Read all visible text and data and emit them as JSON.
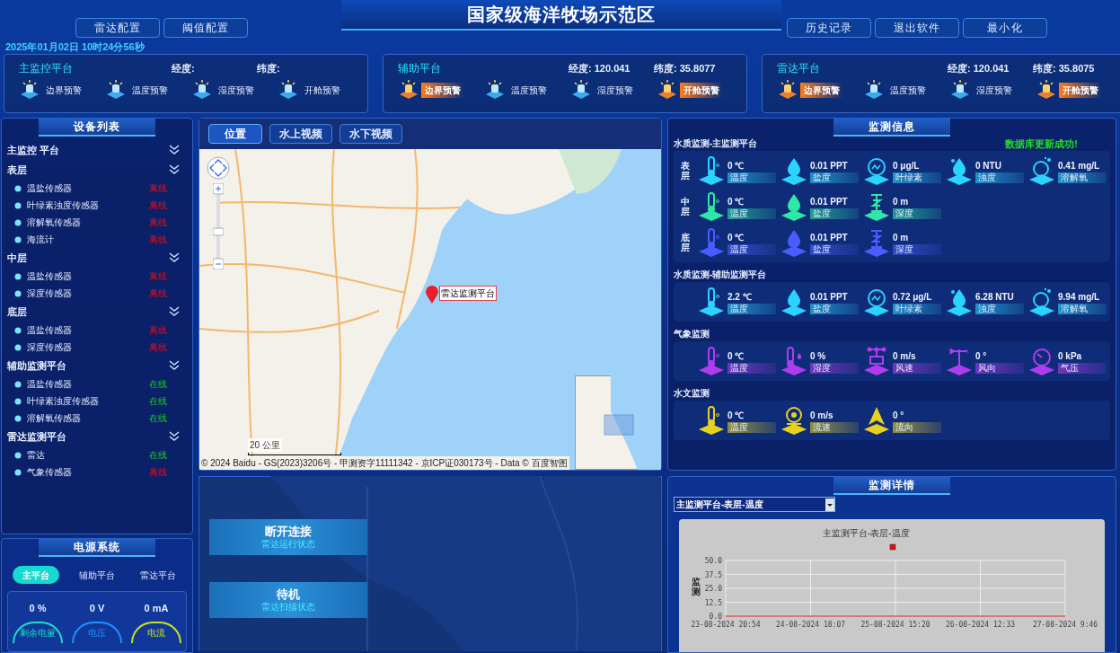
{
  "header": {
    "title": "国家级海洋牧场示范区",
    "left_buttons": [
      "雷达配置",
      "阈值配置"
    ],
    "right_buttons": [
      "历史记录",
      "退出软件",
      "最小化"
    ],
    "datetime": "2025年01月02日 10时24分56秒"
  },
  "platforms": [
    {
      "name": "主监控平台",
      "lon_label": "经度:",
      "lat_label": "纬度:",
      "alarms": [
        {
          "label": "边界预警",
          "active": false
        },
        {
          "label": "温度预警",
          "active": false
        },
        {
          "label": "湿度预警",
          "active": false
        },
        {
          "label": "开舱预警",
          "active": false
        }
      ]
    },
    {
      "name": "辅助平台",
      "lon_label": "经度:",
      "lon": "120.041",
      "lat_label": "纬度:",
      "lat": "35.8077",
      "alarms": [
        {
          "label": "边界预警",
          "active": true
        },
        {
          "label": "温度预警",
          "active": false
        },
        {
          "label": "湿度预警",
          "active": false
        },
        {
          "label": "开舱预警",
          "active": true
        }
      ]
    },
    {
      "name": "雷达平台",
      "lon_label": "经度:",
      "lon": "120.041",
      "lat_label": "纬度:",
      "lat": "35.8075",
      "alarms": [
        {
          "label": "边界预警",
          "active": true
        },
        {
          "label": "温度预警",
          "active": false
        },
        {
          "label": "湿度预警",
          "active": false
        },
        {
          "label": "开舱预警",
          "active": true
        }
      ]
    }
  ],
  "device_list": {
    "title": "设备列表",
    "groups": [
      {
        "label": "主监控 平台",
        "expanded": true,
        "children": [
          {
            "label": "表层",
            "expanded": true,
            "children": [
              {
                "label": "温盐传感器",
                "status": "离线",
                "online": false
              },
              {
                "label": "叶绿素浊度传感器",
                "status": "离线",
                "online": false
              },
              {
                "label": "溶解氧传感器",
                "status": "离线",
                "online": false
              },
              {
                "label": "海流计",
                "status": "离线",
                "online": false
              }
            ]
          },
          {
            "label": "中层",
            "expanded": true,
            "children": [
              {
                "label": "温盐传感器",
                "status": "离线",
                "online": false
              },
              {
                "label": "深度传感器",
                "status": "离线",
                "online": false
              }
            ]
          },
          {
            "label": "底层",
            "expanded": true,
            "children": [
              {
                "label": "温盐传感器",
                "status": "离线",
                "online": false
              },
              {
                "label": "深度传感器",
                "status": "离线",
                "online": false
              }
            ]
          }
        ]
      },
      {
        "label": "辅助监测平台",
        "expanded": true,
        "children": [
          {
            "label": "温盐传感器",
            "status": "在线",
            "online": true
          },
          {
            "label": "叶绿素浊度传感器",
            "status": "在线",
            "online": true
          },
          {
            "label": "溶解氧传感器",
            "status": "在线",
            "online": true
          }
        ]
      },
      {
        "label": "雷达监测平台",
        "expanded": true,
        "children": [
          {
            "label": "雷达",
            "status": "在线",
            "online": true
          },
          {
            "label": "气象传感器",
            "status": "离线",
            "online": false
          }
        ]
      }
    ]
  },
  "power": {
    "title": "电源系统",
    "tabs": [
      {
        "label": "主平台",
        "selected": true
      },
      {
        "label": "辅助平台",
        "selected": false
      },
      {
        "label": "雷达平台",
        "selected": false
      }
    ],
    "readings": [
      {
        "value": "0 %",
        "label": "剩余电量",
        "color": "#19e0c0"
      },
      {
        "value": "0 V",
        "label": "电压",
        "color": "#1e90ff"
      },
      {
        "value": "0 mA",
        "label": "电流",
        "color": "#c8e01e"
      }
    ]
  },
  "map_panel": {
    "tabs": [
      {
        "label": "位置",
        "selected": true
      },
      {
        "label": "水上视频",
        "selected": false
      },
      {
        "label": "水下视频",
        "selected": false
      }
    ],
    "marker_label": "雷达监测平台",
    "scale": "20 公里",
    "copyright": "© 2024 Baidu - GS(2023)3206号 - 甲测资字11111342 - 京ICP证030173号 - Data © 百度智图"
  },
  "radar_panel": {
    "buttons": [
      {
        "label": "断开连接",
        "sub": "雷达运行状态"
      },
      {
        "label": "待机",
        "sub": "雷达扫描状态"
      }
    ]
  },
  "monitor": {
    "title": "监测信息",
    "status": "数据库更新成功!",
    "sections": [
      {
        "title": "水质监测-主监测平台",
        "rows": [
          {
            "layer": "表层",
            "color": "#2ad4ff",
            "items": [
              {
                "kind": "temperature",
                "value": "0 ℃",
                "label": "温度"
              },
              {
                "kind": "salinity",
                "value": "0.01 PPT",
                "label": "盐度"
              },
              {
                "kind": "chlorophyll",
                "value": "0 μg/L",
                "label": "叶绿素"
              },
              {
                "kind": "turbidity",
                "value": "0 NTU",
                "label": "浊度"
              },
              {
                "kind": "oxygen",
                "value": "0.41 mg/L",
                "label": "溶解氧"
              }
            ]
          },
          {
            "layer": "中层",
            "color": "#2ee8a8",
            "items": [
              {
                "kind": "temperature",
                "value": "0 ℃",
                "label": "温度"
              },
              {
                "kind": "salinity",
                "value": "0.01 PPT",
                "label": "盐度"
              },
              {
                "kind": "depth",
                "value": "0 m",
                "label": "深度"
              }
            ]
          },
          {
            "layer": "底层",
            "color": "#4a5cff",
            "items": [
              {
                "kind": "temperature",
                "value": "0 ℃",
                "label": "温度"
              },
              {
                "kind": "salinity",
                "value": "0.01 PPT",
                "label": "盐度"
              },
              {
                "kind": "depth",
                "value": "0 m",
                "label": "深度"
              }
            ]
          }
        ]
      },
      {
        "title": "水质监测-辅助监测平台",
        "rows": [
          {
            "color": "#2ad4ff",
            "items": [
              {
                "kind": "temperature",
                "value": "2.2 ℃",
                "label": "温度"
              },
              {
                "kind": "salinity",
                "value": "0.01 PPT",
                "label": "盐度"
              },
              {
                "kind": "chlorophyll",
                "value": "0.72 μg/L",
                "label": "叶绿素"
              },
              {
                "kind": "turbidity",
                "value": "6.28 NTU",
                "label": "浊度"
              },
              {
                "kind": "oxygen",
                "value": "9.94 mg/L",
                "label": "溶解氧"
              }
            ]
          }
        ]
      },
      {
        "title": "气象监测",
        "rows": [
          {
            "color": "#b03cf0",
            "items": [
              {
                "kind": "temperature",
                "value": "0 ℃",
                "label": "温度"
              },
              {
                "kind": "humidity",
                "value": "0 %",
                "label": "湿度"
              },
              {
                "kind": "wind_speed",
                "value": "0 m/s",
                "label": "风速"
              },
              {
                "kind": "wind_direction",
                "value": "0 °",
                "label": "风向"
              },
              {
                "kind": "pressure",
                "value": "0 kPa",
                "label": "气压"
              }
            ]
          }
        ]
      },
      {
        "title": "水文监测",
        "rows": [
          {
            "color": "#e8d020",
            "items": [
              {
                "kind": "temperature",
                "value": "0 ℃",
                "label": "温度"
              },
              {
                "kind": "flow_speed",
                "value": "0 m/s",
                "label": "流速"
              },
              {
                "kind": "flow_direction",
                "value": "0 °",
                "label": "流向"
              }
            ]
          }
        ]
      }
    ]
  },
  "detail": {
    "title": "监测详情",
    "selector": "主监测平台-表层-温度",
    "chart_data": {
      "type": "line",
      "title": "主监测平台-表层-温度",
      "ylabel": "监测",
      "x": [
        "23-08-2024 20:54",
        "24-08-2024 18:07",
        "25-08-2024 15:20",
        "26-08-2024 12:33",
        "27-08-2024 9:46"
      ],
      "series": [
        {
          "color": "#e01010",
          "values": [
            0,
            0,
            0,
            0,
            0
          ]
        }
      ],
      "grid": true,
      "ylim": [
        0,
        50
      ],
      "yticks": [
        {
          "value": 0,
          "label": "0.0"
        },
        {
          "value": 12.5,
          "label": "12.5"
        },
        {
          "value": 25,
          "label": "25.0"
        },
        {
          "value": 37.5,
          "label": "37.5"
        },
        {
          "value": 50,
          "label": "50.0"
        }
      ]
    }
  }
}
